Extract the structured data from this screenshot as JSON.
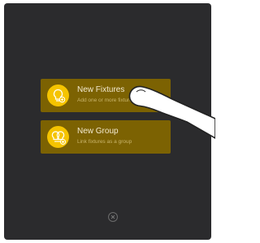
{
  "menu": {
    "new_fixtures": {
      "title": "New Fixtures",
      "description": "Add one or more fixtures",
      "icon": "bulb-add-icon"
    },
    "new_group": {
      "title": "New Group",
      "description": "Link fixtures as a group",
      "icon": "bulb-group-add-icon"
    }
  },
  "close": {
    "icon": "close-circle-icon"
  },
  "colors": {
    "background": "#2b2b2d",
    "card": "#7c6202",
    "accent": "#f5c400"
  }
}
